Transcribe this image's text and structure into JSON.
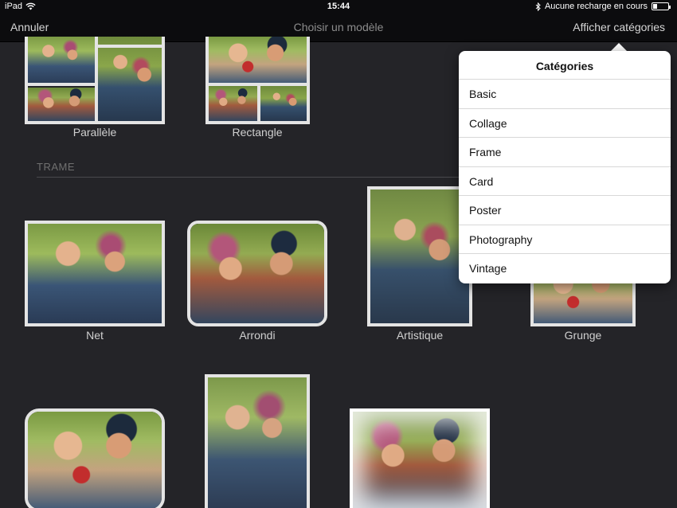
{
  "status_bar": {
    "device": "iPad",
    "time": "15:44",
    "charging_text": "Aucune recharge en cours",
    "battery_level": 0.25
  },
  "nav": {
    "cancel_label": "Annuler",
    "title": "Choisir un modèle",
    "show_categories_label": "Afficher catégories"
  },
  "templates_top": [
    {
      "label": "Parallèle"
    },
    {
      "label": "Rectangle"
    }
  ],
  "section": {
    "title": "TRAME"
  },
  "templates_frame": [
    {
      "label": "Net"
    },
    {
      "label": "Arrondi"
    },
    {
      "label": "Artistique"
    },
    {
      "label": "Grunge"
    }
  ],
  "popover": {
    "title": "Catégories",
    "items": [
      "Basic",
      "Collage",
      "Frame",
      "Card",
      "Poster",
      "Photography",
      "Vintage"
    ]
  },
  "colors": {
    "background": "#242428",
    "bar": "#0c0c0e",
    "frame": "#e4e4e4",
    "popover": "#ffffff"
  }
}
